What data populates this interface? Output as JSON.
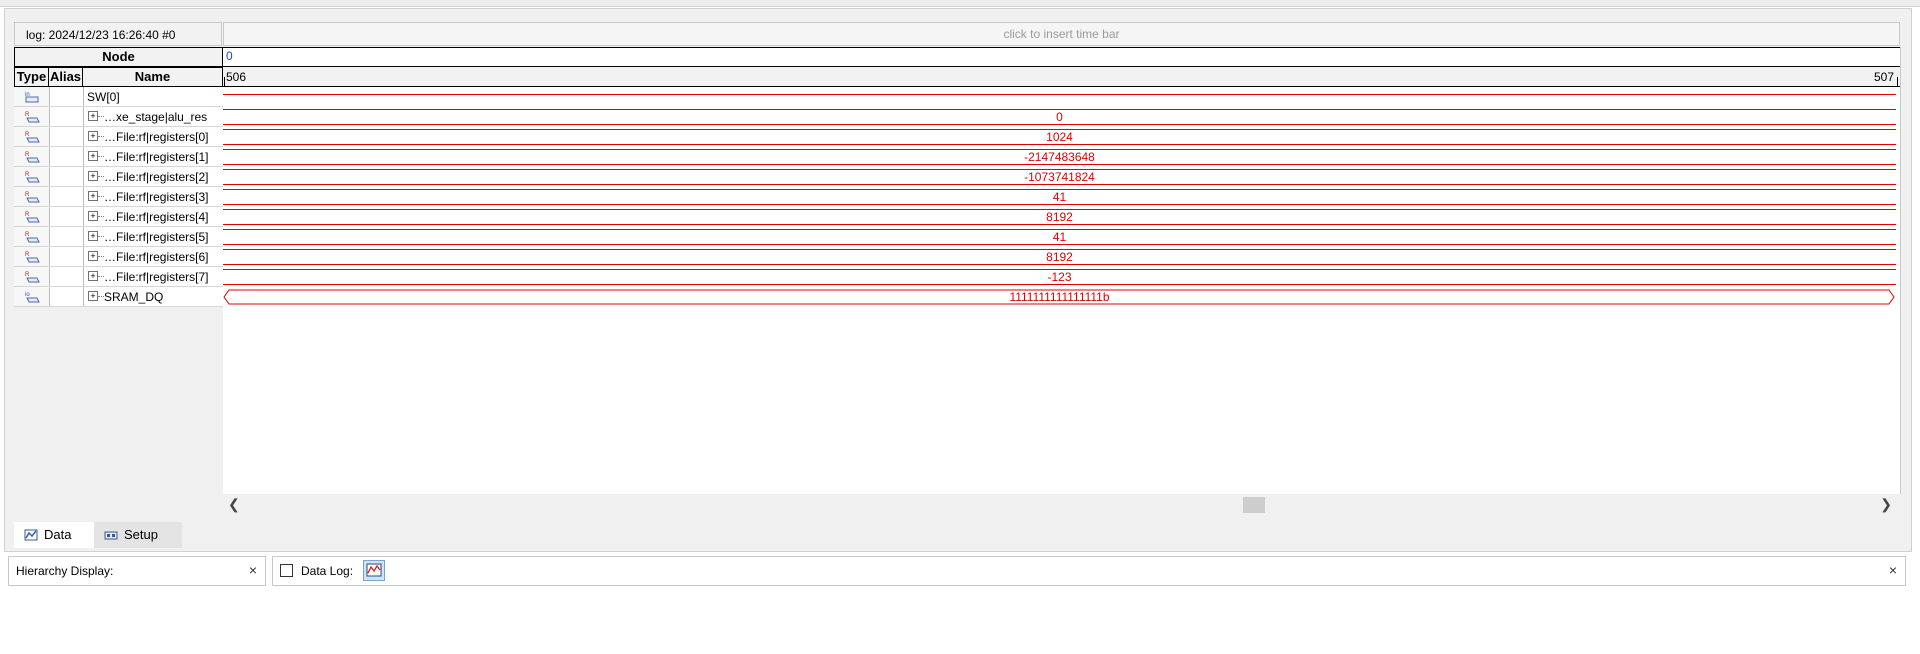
{
  "log": {
    "title": "log: 2024/12/23 16:26:40  #0"
  },
  "timebar": {
    "hint": "click to insert time bar"
  },
  "table": {
    "node_header": "Node",
    "columns": {
      "type": "Type",
      "alias": "Alias",
      "name": "Name"
    }
  },
  "wave": {
    "cursor_zero": "0",
    "scale_left": "506",
    "scale_right": "507"
  },
  "signals": [
    {
      "type_icon": "input-pin-icon",
      "expandable": false,
      "name": "SW[0]",
      "value": ""
    },
    {
      "type_icon": "register-icon",
      "expandable": true,
      "name": "…xe_stage|alu_res",
      "value": "0"
    },
    {
      "type_icon": "register-icon",
      "expandable": true,
      "name": "…File:rf|registers[0]",
      "value": "1024"
    },
    {
      "type_icon": "register-icon",
      "expandable": true,
      "name": "…File:rf|registers[1]",
      "value": "-2147483648"
    },
    {
      "type_icon": "register-icon",
      "expandable": true,
      "name": "…File:rf|registers[2]",
      "value": "-1073741824"
    },
    {
      "type_icon": "register-icon",
      "expandable": true,
      "name": "…File:rf|registers[3]",
      "value": "41"
    },
    {
      "type_icon": "register-icon",
      "expandable": true,
      "name": "…File:rf|registers[4]",
      "value": "8192"
    },
    {
      "type_icon": "register-icon",
      "expandable": true,
      "name": "…File:rf|registers[5]",
      "value": "41"
    },
    {
      "type_icon": "register-icon",
      "expandable": true,
      "name": "…File:rf|registers[6]",
      "value": "8192"
    },
    {
      "type_icon": "register-icon",
      "expandable": true,
      "name": "…File:rf|registers[7]",
      "value": "-123"
    },
    {
      "type_icon": "bidir-pin-icon",
      "expandable": true,
      "name": "SRAM_DQ",
      "value": "1111111111111111b"
    }
  ],
  "tabs": {
    "data": "Data",
    "setup": "Setup"
  },
  "hierarchy": {
    "title": "Hierarchy Display:",
    "close": "×"
  },
  "datalog": {
    "title": "Data Log:",
    "close": "×"
  },
  "colors": {
    "waveform": "#e00000",
    "cursor": "#1f3fcf"
  }
}
